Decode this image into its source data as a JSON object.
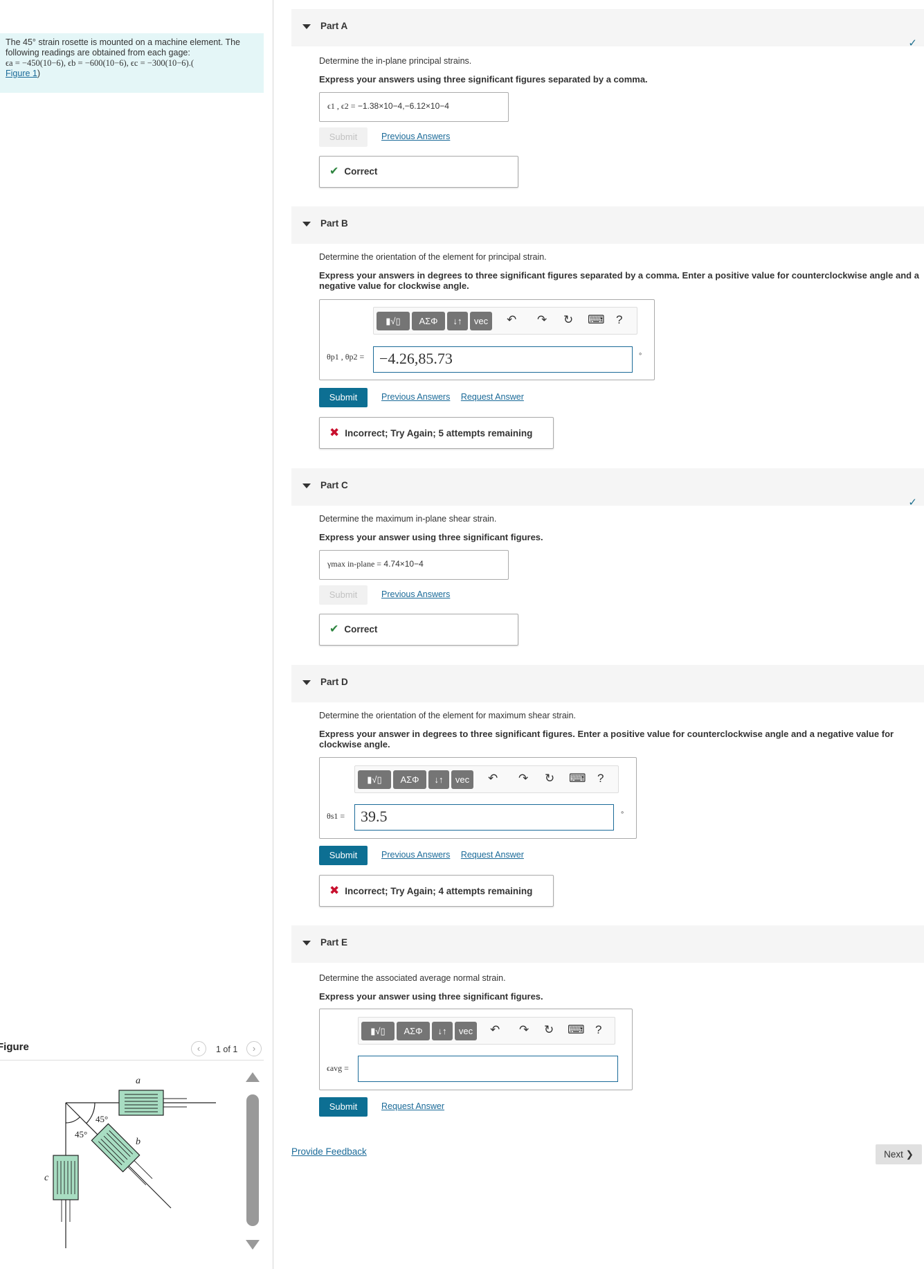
{
  "problem": {
    "text": "The 45° strain rosette is mounted on a machine element. The following readings are obtained from each gage:",
    "readings": "ϵa = −450(10−6), ϵb = −600(10−6), ϵc = −300(10−6).(",
    "figure_link": "Figure 1",
    "close_paren": ")"
  },
  "figure": {
    "title": "Figure",
    "pager": "1 of 1",
    "prev_glyph": "‹",
    "next_glyph": "›",
    "labels": {
      "a": "a",
      "b": "b",
      "c": "c",
      "angle_top": "45°",
      "angle_bottom": "45°"
    }
  },
  "colors": {
    "gage_fill": "#a8ddc2",
    "accent": "#0d6f93",
    "link": "#1a6a98",
    "correct": "#2e8540",
    "incorrect": "#c8102e"
  },
  "toolbar": {
    "templates": "▮√▯",
    "greek": "ΑΣΦ",
    "arrows": "↓↑",
    "vec": "vec",
    "undo": "↶",
    "redo": "↷",
    "reset": "↻",
    "keyboard": "⌨",
    "help": "?"
  },
  "parts": {
    "a": {
      "title": "Part A",
      "question": "Determine the in-plane principal strains.",
      "instruction": "Express your answers using three significant figures separated by a comma.",
      "answer_label": "ϵ1 , ϵ2 =",
      "answer_value": "−1.38×10−4,−6.12×10−4",
      "submit": "Submit",
      "previous": "Previous Answers",
      "feedback": "Correct"
    },
    "b": {
      "title": "Part B",
      "question": "Determine the orientation of the element for principal strain.",
      "instruction": "Express your answers in degrees to three significant figures separated by a comma. Enter a positive value for counterclockwise angle and a negative value for clockwise angle.",
      "eq_label": "θp1 , θp2 =",
      "input_value": "−4.26,85.73",
      "unit": "∘",
      "submit": "Submit",
      "previous": "Previous Answers",
      "request": "Request Answer",
      "feedback": "Incorrect; Try Again; 5 attempts remaining"
    },
    "c": {
      "title": "Part C",
      "question": "Determine the maximum in-plane shear strain.",
      "instruction": "Express your answer using three significant figures.",
      "answer_label": "γmax in-plane =",
      "answer_value": "4.74×10−4",
      "submit": "Submit",
      "previous": "Previous Answers",
      "feedback": "Correct"
    },
    "d": {
      "title": "Part D",
      "question": "Determine the orientation of the element for maximum shear strain.",
      "instruction": "Express your answer in degrees to three significant figures. Enter a positive value for counterclockwise angle and a negative value for clockwise angle.",
      "eq_label": "θs1 =",
      "input_value": "39.5",
      "unit": "∘",
      "submit": "Submit",
      "previous": "Previous Answers",
      "request": "Request Answer",
      "feedback": "Incorrect; Try Again; 4 attempts remaining"
    },
    "e": {
      "title": "Part E",
      "question": "Determine the associated average normal strain.",
      "instruction": "Express your answer using three significant figures.",
      "eq_label": "ϵavg =",
      "input_value": "",
      "submit": "Submit",
      "request": "Request Answer"
    }
  },
  "footer": {
    "provide_feedback": "Provide Feedback",
    "next": "Next ❯"
  }
}
